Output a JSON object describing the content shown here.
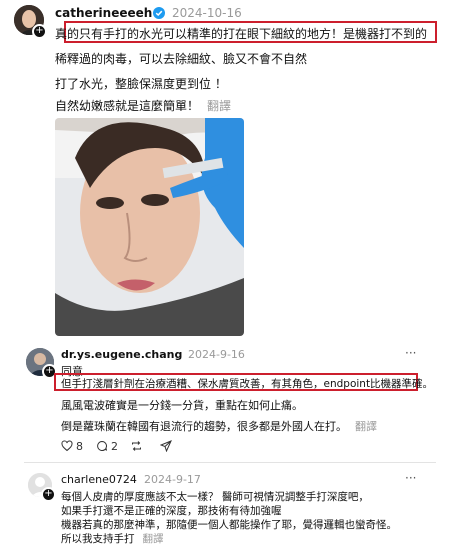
{
  "post": {
    "username": "catherineeeeh",
    "date": "2024-10-16",
    "line1": "真的只有手打的水光可以精準的打在眼下細紋的地方！是機器打不到的",
    "line2": "稀釋過的肉毒，可以去除細紋、臉又不會不自然",
    "line3": "打了水光，整臉保濕度更到位 ！",
    "line4": "自然幼嫩感就是這麼簡單！",
    "translate": "翻譯"
  },
  "reply1": {
    "username": "dr.ys.eugene.chang",
    "date": "2024-9-16",
    "line1": "同意",
    "line2": "但手打淺層針劑在治療酒糟、保水膚質改善，有其角色，endpoint比機器準確。",
    "line3": "風風電波確實是一分錢一分貨，重點在如何止痛。",
    "line4": "倒是蘿珠蘭在韓國有退流行的趨勢，很多都是外國人在打。",
    "translate": "翻譯",
    "likes": "8",
    "comments": "2",
    "more": "···"
  },
  "reply2": {
    "username": "charlene0724",
    "date": "2024-9-17",
    "line1": "每個人皮膚的厚度應該不太一樣？ 醫師可視情況調整手打深度吧，",
    "line2": "如果手打還不是正確的深度，那技術有待加強喔",
    "line3": "機器若真的那麼神準，那隨便一個人都能操作了耶，覺得邏輯也蠻奇怪。",
    "line4": "所以我支持手打",
    "translate": "翻譯",
    "more": "···"
  },
  "icons": [
    "verified-badge-icon",
    "heart-icon",
    "comment-icon",
    "repost-icon",
    "share-icon",
    "more-options-icon",
    "plus-icon"
  ],
  "colors": {
    "highlight": "#cc1f2d",
    "verified": "#1d9bf0",
    "glove": "#2f8fe0"
  }
}
